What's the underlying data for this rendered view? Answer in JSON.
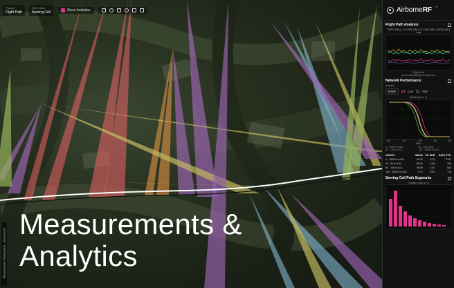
{
  "toolbar": {
    "project_label": "Project",
    "project_value": "Flight Path",
    "field_label": "Field Value",
    "field_value": "Serving Cell",
    "show_analytics": "Show Analytics"
  },
  "side_label": "Measurement Visualization - Serving Cell",
  "headline": {
    "line1": "Measurements &",
    "line2": "Analytics"
  },
  "brand": {
    "name_light": "Airborne",
    "name_bold": "RF",
    "tm": "TM"
  },
  "flight_path_analysis": {
    "title": "Flight Path Analysis",
    "legend": "RSRP (dBm) | UL SINR (dB) | DL SINR (dB) | RSRQ (dB) | Logs",
    "x_label": "Flight path",
    "hint": "(Focus by clicking on chart line)"
  },
  "network_performance": {
    "title": "Network Performance",
    "indicator_label": "Indicator",
    "indicator_value": "RSRP",
    "radio_cdf": "CDF",
    "radio_pdf": "PDF",
    "chart_title": "Distribution in %",
    "x_label": "dBm",
    "x_ticks": [
      "-140",
      "-120",
      "-100",
      "-80",
      "-60"
    ],
    "legend": [
      "0 - 30000 m AGL",
      "30 - 60 m AGL",
      "60 - 100 m AGL",
      "100 - 30000 m AGL"
    ]
  },
  "stats_table": {
    "headers": [
      "HEIGHT",
      "MEAN",
      "5% ERR",
      "DATA PTS."
    ],
    "rows": [
      [
        "0 - 30000 m AGL",
        "-95.33",
        "5.33",
        "2787"
      ],
      [
        "30 - 60 m AGL",
        "-88.36",
        "3.86",
        "780"
      ],
      [
        "60 - 100 m AGL",
        "-95.09",
        "4.62",
        "546"
      ],
      [
        "100 - 30000 m AGL",
        "-97.6",
        "5.83",
        "716"
      ]
    ]
  },
  "serving_cell": {
    "title": "Serving Cell Path Segments",
    "chart_title": "Relative share in %"
  },
  "colors": {
    "accent": "#e0338a",
    "panel_bg": "#101311"
  }
}
